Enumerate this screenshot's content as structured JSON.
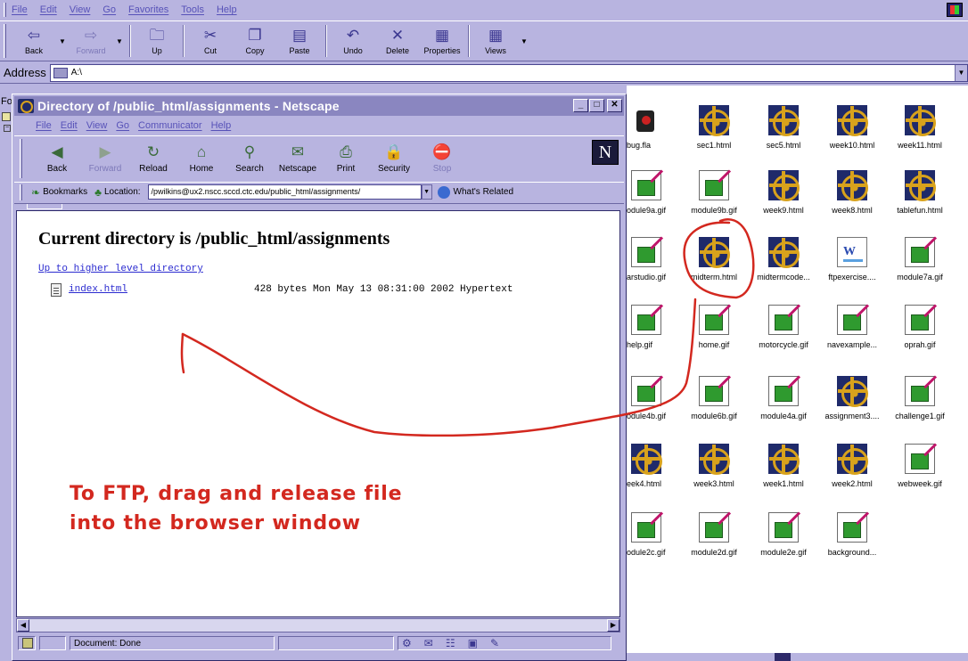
{
  "explorer": {
    "menu": [
      "File",
      "Edit",
      "View",
      "Go",
      "Favorites",
      "Tools",
      "Help"
    ],
    "toolbar": [
      {
        "label": "Back",
        "icon": "back-arrow-icon",
        "glyph": "⇦",
        "dropdown": true,
        "disabled": false
      },
      {
        "label": "Forward",
        "icon": "forward-arrow-icon",
        "glyph": "⇨",
        "dropdown": true,
        "disabled": true
      },
      {
        "label": "Up",
        "icon": "folder-up-icon",
        "glyph": "🗀",
        "dropdown": false,
        "disabled": false
      },
      {
        "label": "Cut",
        "icon": "scissors-icon",
        "glyph": "✂",
        "dropdown": false,
        "disabled": false
      },
      {
        "label": "Copy",
        "icon": "copy-icon",
        "glyph": "❐",
        "dropdown": false,
        "disabled": false
      },
      {
        "label": "Paste",
        "icon": "paste-icon",
        "glyph": "▤",
        "dropdown": false,
        "disabled": false
      },
      {
        "label": "Undo",
        "icon": "undo-icon",
        "glyph": "↶",
        "dropdown": false,
        "disabled": false
      },
      {
        "label": "Delete",
        "icon": "delete-x-icon",
        "glyph": "✕",
        "dropdown": false,
        "disabled": false
      },
      {
        "label": "Properties",
        "icon": "properties-icon",
        "glyph": "▦",
        "dropdown": false,
        "disabled": false
      },
      {
        "label": "Views",
        "icon": "views-grid-icon",
        "glyph": "▦",
        "dropdown": true,
        "disabled": false
      }
    ],
    "address_label": "Address",
    "address_value": "A:\\",
    "left_strip_text": "Fo",
    "files": [
      {
        "name": "bug.fla",
        "type": "fla"
      },
      {
        "name": "sec1.html",
        "type": "wheel"
      },
      {
        "name": "sec5.html",
        "type": "wheel"
      },
      {
        "name": "week10.html",
        "type": "wheel"
      },
      {
        "name": "week11.html",
        "type": "wheel"
      },
      {
        "name": "odule9a.gif",
        "type": "gif"
      },
      {
        "name": "module9b.gif",
        "type": "gif"
      },
      {
        "name": "week9.html",
        "type": "wheel"
      },
      {
        "name": "week8.html",
        "type": "wheel"
      },
      {
        "name": "tablefun.html",
        "type": "wheel"
      },
      {
        "name": "arstudio.gif",
        "type": "gif"
      },
      {
        "name": "midterm.html",
        "type": "wheel"
      },
      {
        "name": "midtermcode...",
        "type": "wheel"
      },
      {
        "name": "ftpexercise....",
        "type": "doc"
      },
      {
        "name": "module7a.gif",
        "type": "gif"
      },
      {
        "name": "help.gif",
        "type": "gif"
      },
      {
        "name": "home.gif",
        "type": "gif"
      },
      {
        "name": "motorcycle.gif",
        "type": "gif"
      },
      {
        "name": "navexample...",
        "type": "gif"
      },
      {
        "name": "oprah.gif",
        "type": "gif"
      },
      {
        "name": "odule4b.gif",
        "type": "gif"
      },
      {
        "name": "module6b.gif",
        "type": "gif"
      },
      {
        "name": "module4a.gif",
        "type": "gif"
      },
      {
        "name": "assignment3....",
        "type": "wheel"
      },
      {
        "name": "challenge1.gif",
        "type": "gif"
      },
      {
        "name": "eek4.html",
        "type": "wheel"
      },
      {
        "name": "week3.html",
        "type": "wheel"
      },
      {
        "name": "week1.html",
        "type": "wheel"
      },
      {
        "name": "week2.html",
        "type": "wheel"
      },
      {
        "name": "webweek.gif",
        "type": "gif"
      },
      {
        "name": "odule2c.gif",
        "type": "gif"
      },
      {
        "name": "module2d.gif",
        "type": "gif"
      },
      {
        "name": "module2e.gif",
        "type": "gif"
      },
      {
        "name": "background...",
        "type": "gif"
      }
    ]
  },
  "netscape": {
    "title": "Directory of /public_html/assignments - Netscape",
    "menu": [
      "File",
      "Edit",
      "View",
      "Go",
      "Communicator",
      "Help"
    ],
    "toolbar": [
      {
        "label": "Back",
        "icon": "back-arrow-icon",
        "glyph": "◀",
        "disabled": false
      },
      {
        "label": "Forward",
        "icon": "forward-arrow-icon",
        "glyph": "▶",
        "disabled": true
      },
      {
        "label": "Reload",
        "icon": "reload-icon",
        "glyph": "↻",
        "disabled": false
      },
      {
        "label": "Home",
        "icon": "home-icon",
        "glyph": "⌂",
        "disabled": false
      },
      {
        "label": "Search",
        "icon": "search-icon",
        "glyph": "⚲",
        "disabled": false
      },
      {
        "label": "Netscape",
        "icon": "netscape-icon",
        "glyph": "✉",
        "disabled": false
      },
      {
        "label": "Print",
        "icon": "printer-icon",
        "glyph": "⎙",
        "disabled": false
      },
      {
        "label": "Security",
        "icon": "lock-icon",
        "glyph": "🔒",
        "disabled": false
      },
      {
        "label": "Stop",
        "icon": "stop-icon",
        "glyph": "⛔",
        "disabled": true
      }
    ],
    "logo": "N",
    "bookmarks_label": "Bookmarks",
    "location_label": "Location:",
    "location_value": "/pwilkins@ux2.nscc.sccd.ctc.edu/public_html/assignments/",
    "whats_related": "What's Related",
    "heading": "Current directory is /public_html/assignments",
    "up_link": "Up to higher level directory",
    "entry_name": "index.html",
    "entry_meta": "428 bytes Mon May 13 08:31:00 2002 Hypertext",
    "status_text": "Document: Done"
  },
  "annotation": {
    "line1": "To FTP, drag and release file",
    "line2": "into the browser window",
    "color": "#d3281f"
  }
}
